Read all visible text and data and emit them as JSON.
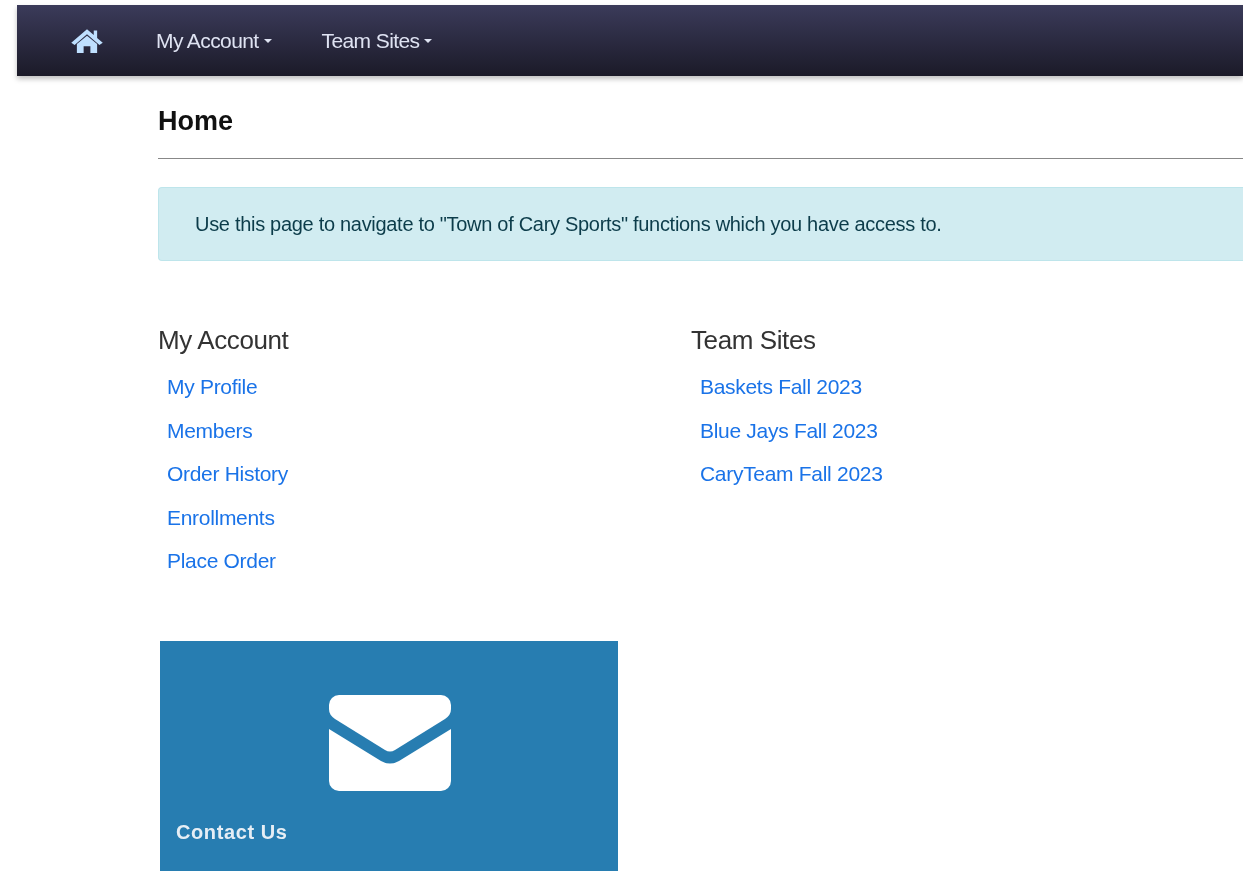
{
  "navbar": {
    "menus": [
      {
        "label": "My Account"
      },
      {
        "label": "Team Sites"
      }
    ]
  },
  "page": {
    "title": "Home"
  },
  "alert": {
    "text": "Use this page to navigate to \"Town of Cary Sports\" functions which you have access to."
  },
  "sections": [
    {
      "title": "My Account",
      "links": [
        "My Profile",
        "Members",
        "Order History",
        "Enrollments",
        "Place Order"
      ]
    },
    {
      "title": "Team Sites",
      "links": [
        "Baskets Fall 2023",
        "Blue Jays Fall 2023",
        "CaryTeam Fall 2023"
      ]
    }
  ],
  "tile": {
    "label": "Contact Us"
  }
}
